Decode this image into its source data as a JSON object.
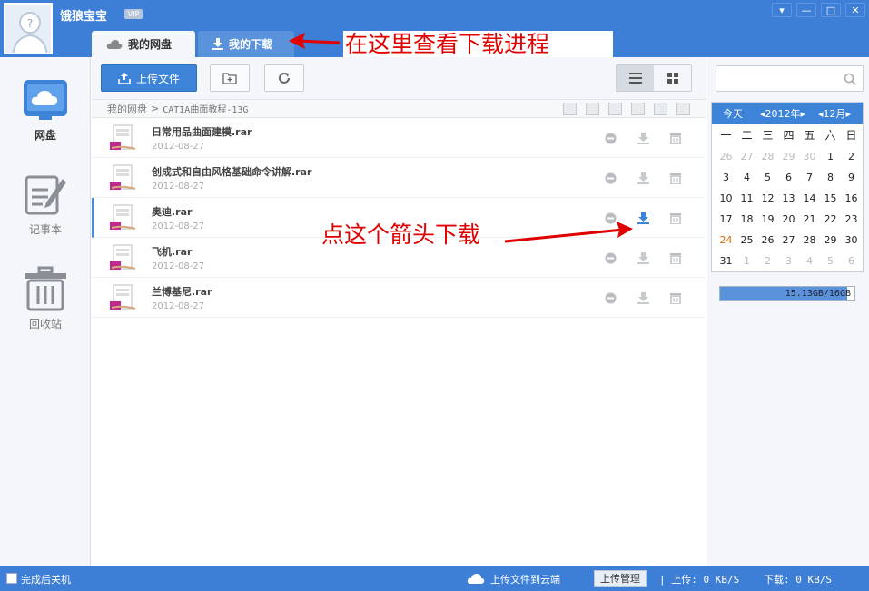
{
  "header": {
    "username": "饿狼宝宝",
    "vip_badge": "VIP",
    "window_buttons": [
      "▾",
      "—",
      "□",
      "✕"
    ]
  },
  "tabs": [
    {
      "label": "我的网盘",
      "icon": "cloud-icon",
      "active": true
    },
    {
      "label": "我的下载",
      "icon": "download-icon",
      "active": false
    }
  ],
  "annotations": {
    "tab_note": "在这里查看下载进程",
    "arrow_note": "点这个箭头下载",
    "color": "#e00000"
  },
  "sidebar": {
    "items": [
      {
        "label": "网盘",
        "icon": "cloud-monitor-icon",
        "active": true
      },
      {
        "label": "记事本",
        "icon": "notepad-icon",
        "active": false
      },
      {
        "label": "回收站",
        "icon": "trash-icon",
        "active": false
      }
    ]
  },
  "toolbar": {
    "upload_label": "上传文件"
  },
  "breadcrumb": {
    "root": "我的网盘",
    "separator": ">",
    "path": "CATIA曲面教程-13G"
  },
  "files": [
    {
      "name": "日常用品曲面建模.rar",
      "date": "2012-08-27"
    },
    {
      "name": "创成式和自由风格基础命令讲解.rar",
      "date": "2012-08-27"
    },
    {
      "name": "奥迪.rar",
      "date": "2012-08-27"
    },
    {
      "name": "飞机.rar",
      "date": "2012-08-27"
    },
    {
      "name": "兰博基尼.rar",
      "date": "2012-08-27"
    }
  ],
  "calendar": {
    "today_label": "今天",
    "year_label": "◂2012年▸",
    "month_label": "◂12月▸",
    "weekdays": [
      "一",
      "二",
      "三",
      "四",
      "五",
      "六",
      "日"
    ],
    "days": [
      "26",
      "27",
      "28",
      "29",
      "30",
      "1",
      "2",
      "3",
      "4",
      "5",
      "6",
      "7",
      "8",
      "9",
      "10",
      "11",
      "12",
      "13",
      "14",
      "15",
      "16",
      "17",
      "18",
      "19",
      "20",
      "21",
      "22",
      "23",
      "24",
      "25",
      "26",
      "27",
      "28",
      "29",
      "30",
      "31",
      "1",
      "2",
      "3",
      "4",
      "5",
      "6"
    ],
    "today_value": "24"
  },
  "quota": {
    "text": "15.13GB/16GB",
    "used_fraction": 0.945
  },
  "statusbar": {
    "shutdown_label": "完成后关机",
    "cloud_label": "上传文件到云端",
    "upload_manager_label": "上传管理",
    "upload_speed": "| 上传: 0 KB/S",
    "download_speed": "下载: 0 KB/S"
  },
  "colors": {
    "brand_blue": "#3d7ed6",
    "accent_blue": "#3d84d9",
    "annotation_red": "#e00000"
  }
}
